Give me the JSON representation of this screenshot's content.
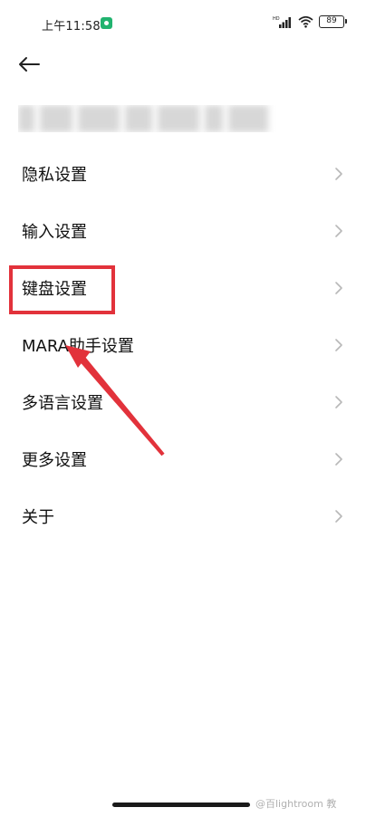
{
  "status_bar": {
    "time": "上午11:58",
    "network_label": "HD",
    "battery_level": "89",
    "icons": [
      "app-notification-icon",
      "signal-icon",
      "wifi-icon",
      "battery-icon"
    ]
  },
  "navigation": {
    "back_icon": "back-arrow-icon"
  },
  "menu": {
    "items": [
      {
        "label": "隐私设置"
      },
      {
        "label": "输入设置"
      },
      {
        "label": "键盘设置"
      },
      {
        "label": "MARA助手设置"
      },
      {
        "label": "多语言设置"
      },
      {
        "label": "更多设置"
      },
      {
        "label": "关于"
      }
    ]
  },
  "annotation": {
    "highlight_color": "#e2323b",
    "highlighted_item": "键盘设置"
  },
  "watermark": {
    "text": "@百lightroom 教"
  },
  "colors": {
    "background": "#ffffff",
    "text": "#111111",
    "chevron": "#b8b8b8",
    "accent_red": "#e2323b",
    "app_icon_green": "#21b36f"
  }
}
